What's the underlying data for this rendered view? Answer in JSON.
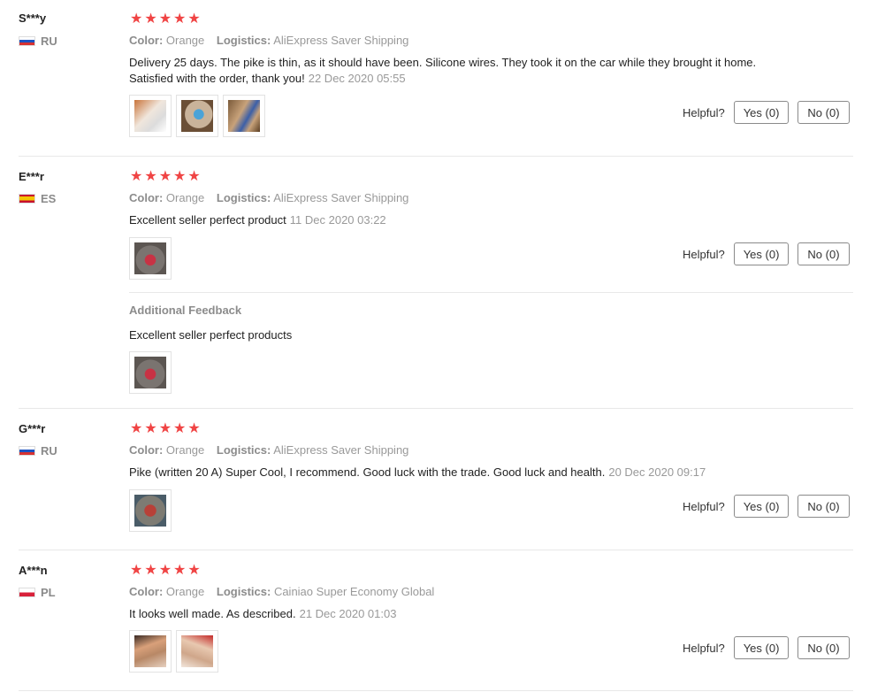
{
  "feedback": {
    "helpful_label": "Helpful?",
    "additional_feedback_title": "Additional Feedback",
    "reviews": [
      {
        "user": "S***y",
        "country": "RU",
        "rating": 5,
        "color_label": "Color:",
        "color": "Orange",
        "logistics_label": "Logistics:",
        "logistics": "AliExpress Saver Shipping",
        "text": "Delivery 25 days. The pike is thin, as it should have been. Silicone wires. They took it on the car while they brought it home. Satisfied with the order, thank you!",
        "date": "22 Dec 2020 05:55",
        "photos": 3,
        "yes": "Yes (0)",
        "no": "No (0)"
      },
      {
        "user": "E***r",
        "country": "ES",
        "rating": 5,
        "color_label": "Color:",
        "color": "Orange",
        "logistics_label": "Logistics:",
        "logistics": "AliExpress Saver Shipping",
        "text": "Excellent seller perfect product",
        "date": "11 Dec 2020 03:22",
        "photos": 1,
        "yes": "Yes (0)",
        "no": "No (0)",
        "additional_text": "Excellent seller perfect products",
        "additional_photos": 1
      },
      {
        "user": "G***r",
        "country": "RU",
        "rating": 5,
        "color_label": "Color:",
        "color": "Orange",
        "logistics_label": "Logistics:",
        "logistics": "AliExpress Saver Shipping",
        "text": "Pike (written 20 A) Super Cool, I recommend. Good luck with the trade. Good luck and health.",
        "date": "20 Dec 2020 09:17",
        "photos": 1,
        "yes": "Yes (0)",
        "no": "No (0)"
      },
      {
        "user": "A***n",
        "country": "PL",
        "rating": 5,
        "color_label": "Color:",
        "color": "Orange",
        "logistics_label": "Logistics:",
        "logistics": "Cainiao Super Economy Global",
        "text": "It looks well made. As described.",
        "date": "21 Dec 2020 01:03",
        "photos": 2,
        "yes": "Yes (0)",
        "no": "No (0)"
      }
    ]
  },
  "colors": {
    "star": "#f04444",
    "divider": "#e8e8e8",
    "muted_text": "#999999"
  }
}
